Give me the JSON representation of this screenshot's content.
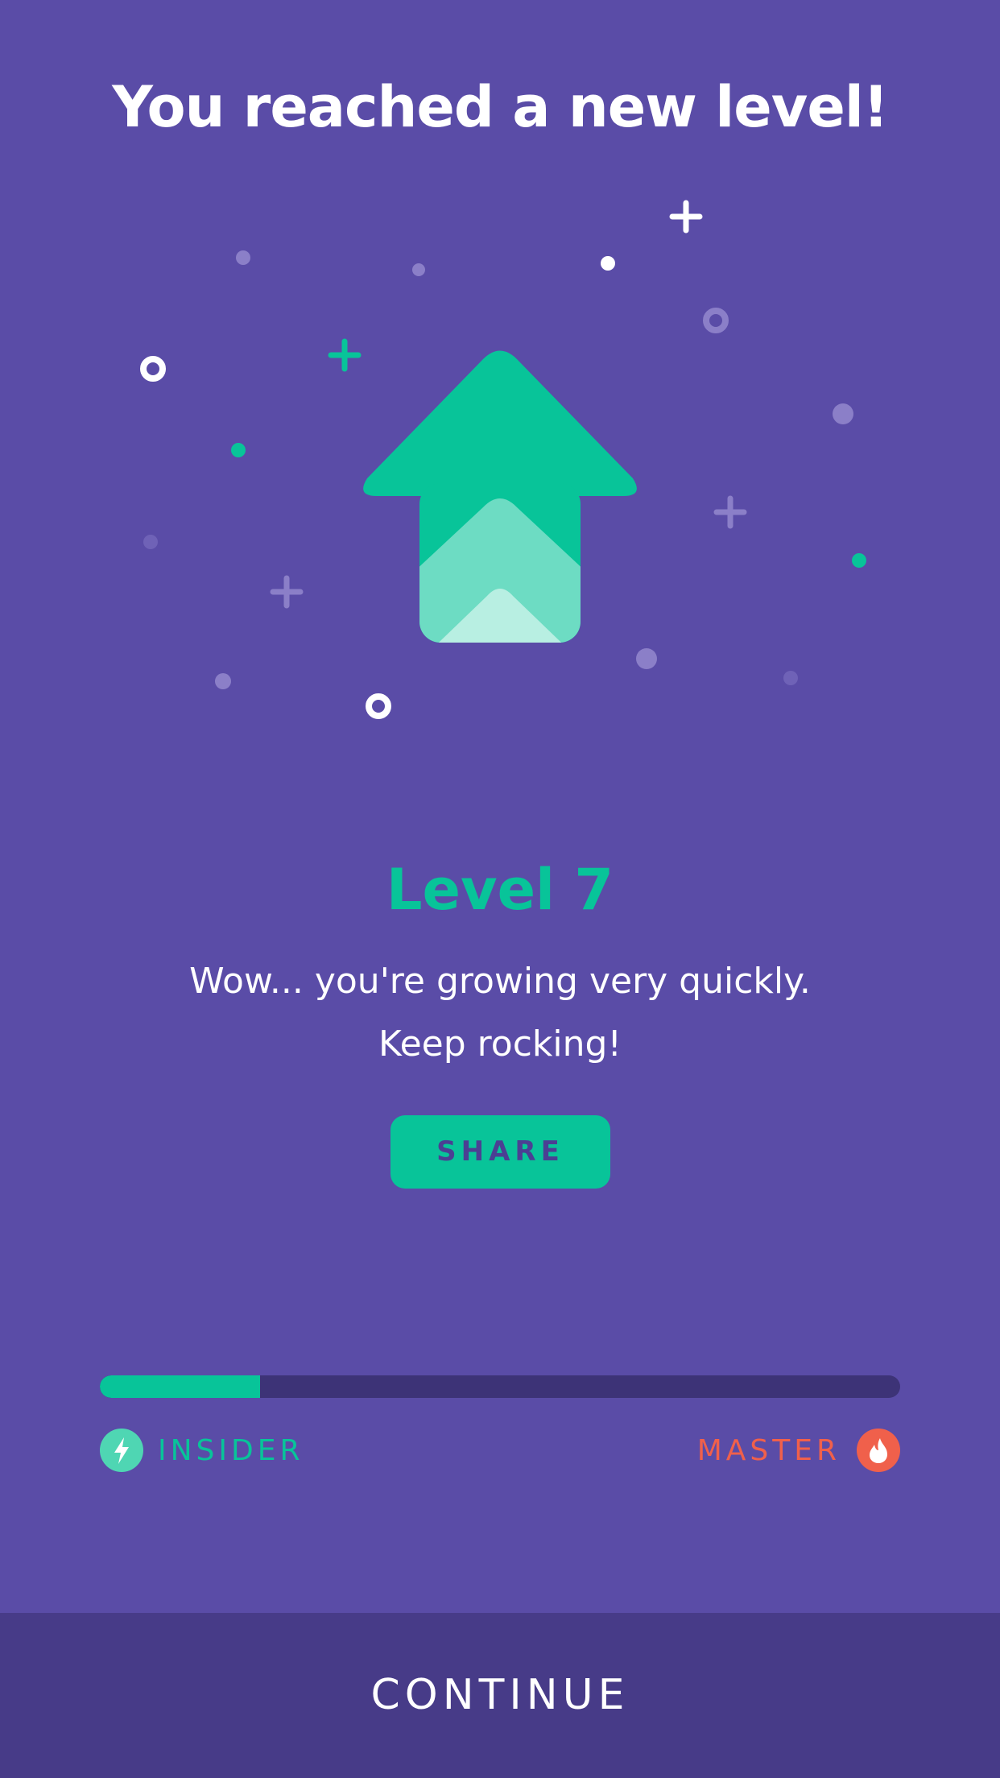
{
  "header": {
    "title": "You reached a new level!"
  },
  "illustration": {
    "icon": "level-up-arrow-icon"
  },
  "level": {
    "title": "Level 7",
    "message_line1": "Wow... you're growing very quickly.",
    "message_line2": "Keep rocking!"
  },
  "share": {
    "label": "SHARE"
  },
  "progress": {
    "value": 0.2,
    "start_tier": "INSIDER",
    "start_icon": "lightning-bolt-icon",
    "end_tier": "MASTER",
    "end_icon": "flame-icon"
  },
  "footer": {
    "continue_label": "CONTINUE"
  },
  "colors": {
    "background": "#5a4ca7",
    "accent_green": "#08c499",
    "accent_red": "#f0604b",
    "footer_bar": "#473b88",
    "track": "#3d3377"
  }
}
